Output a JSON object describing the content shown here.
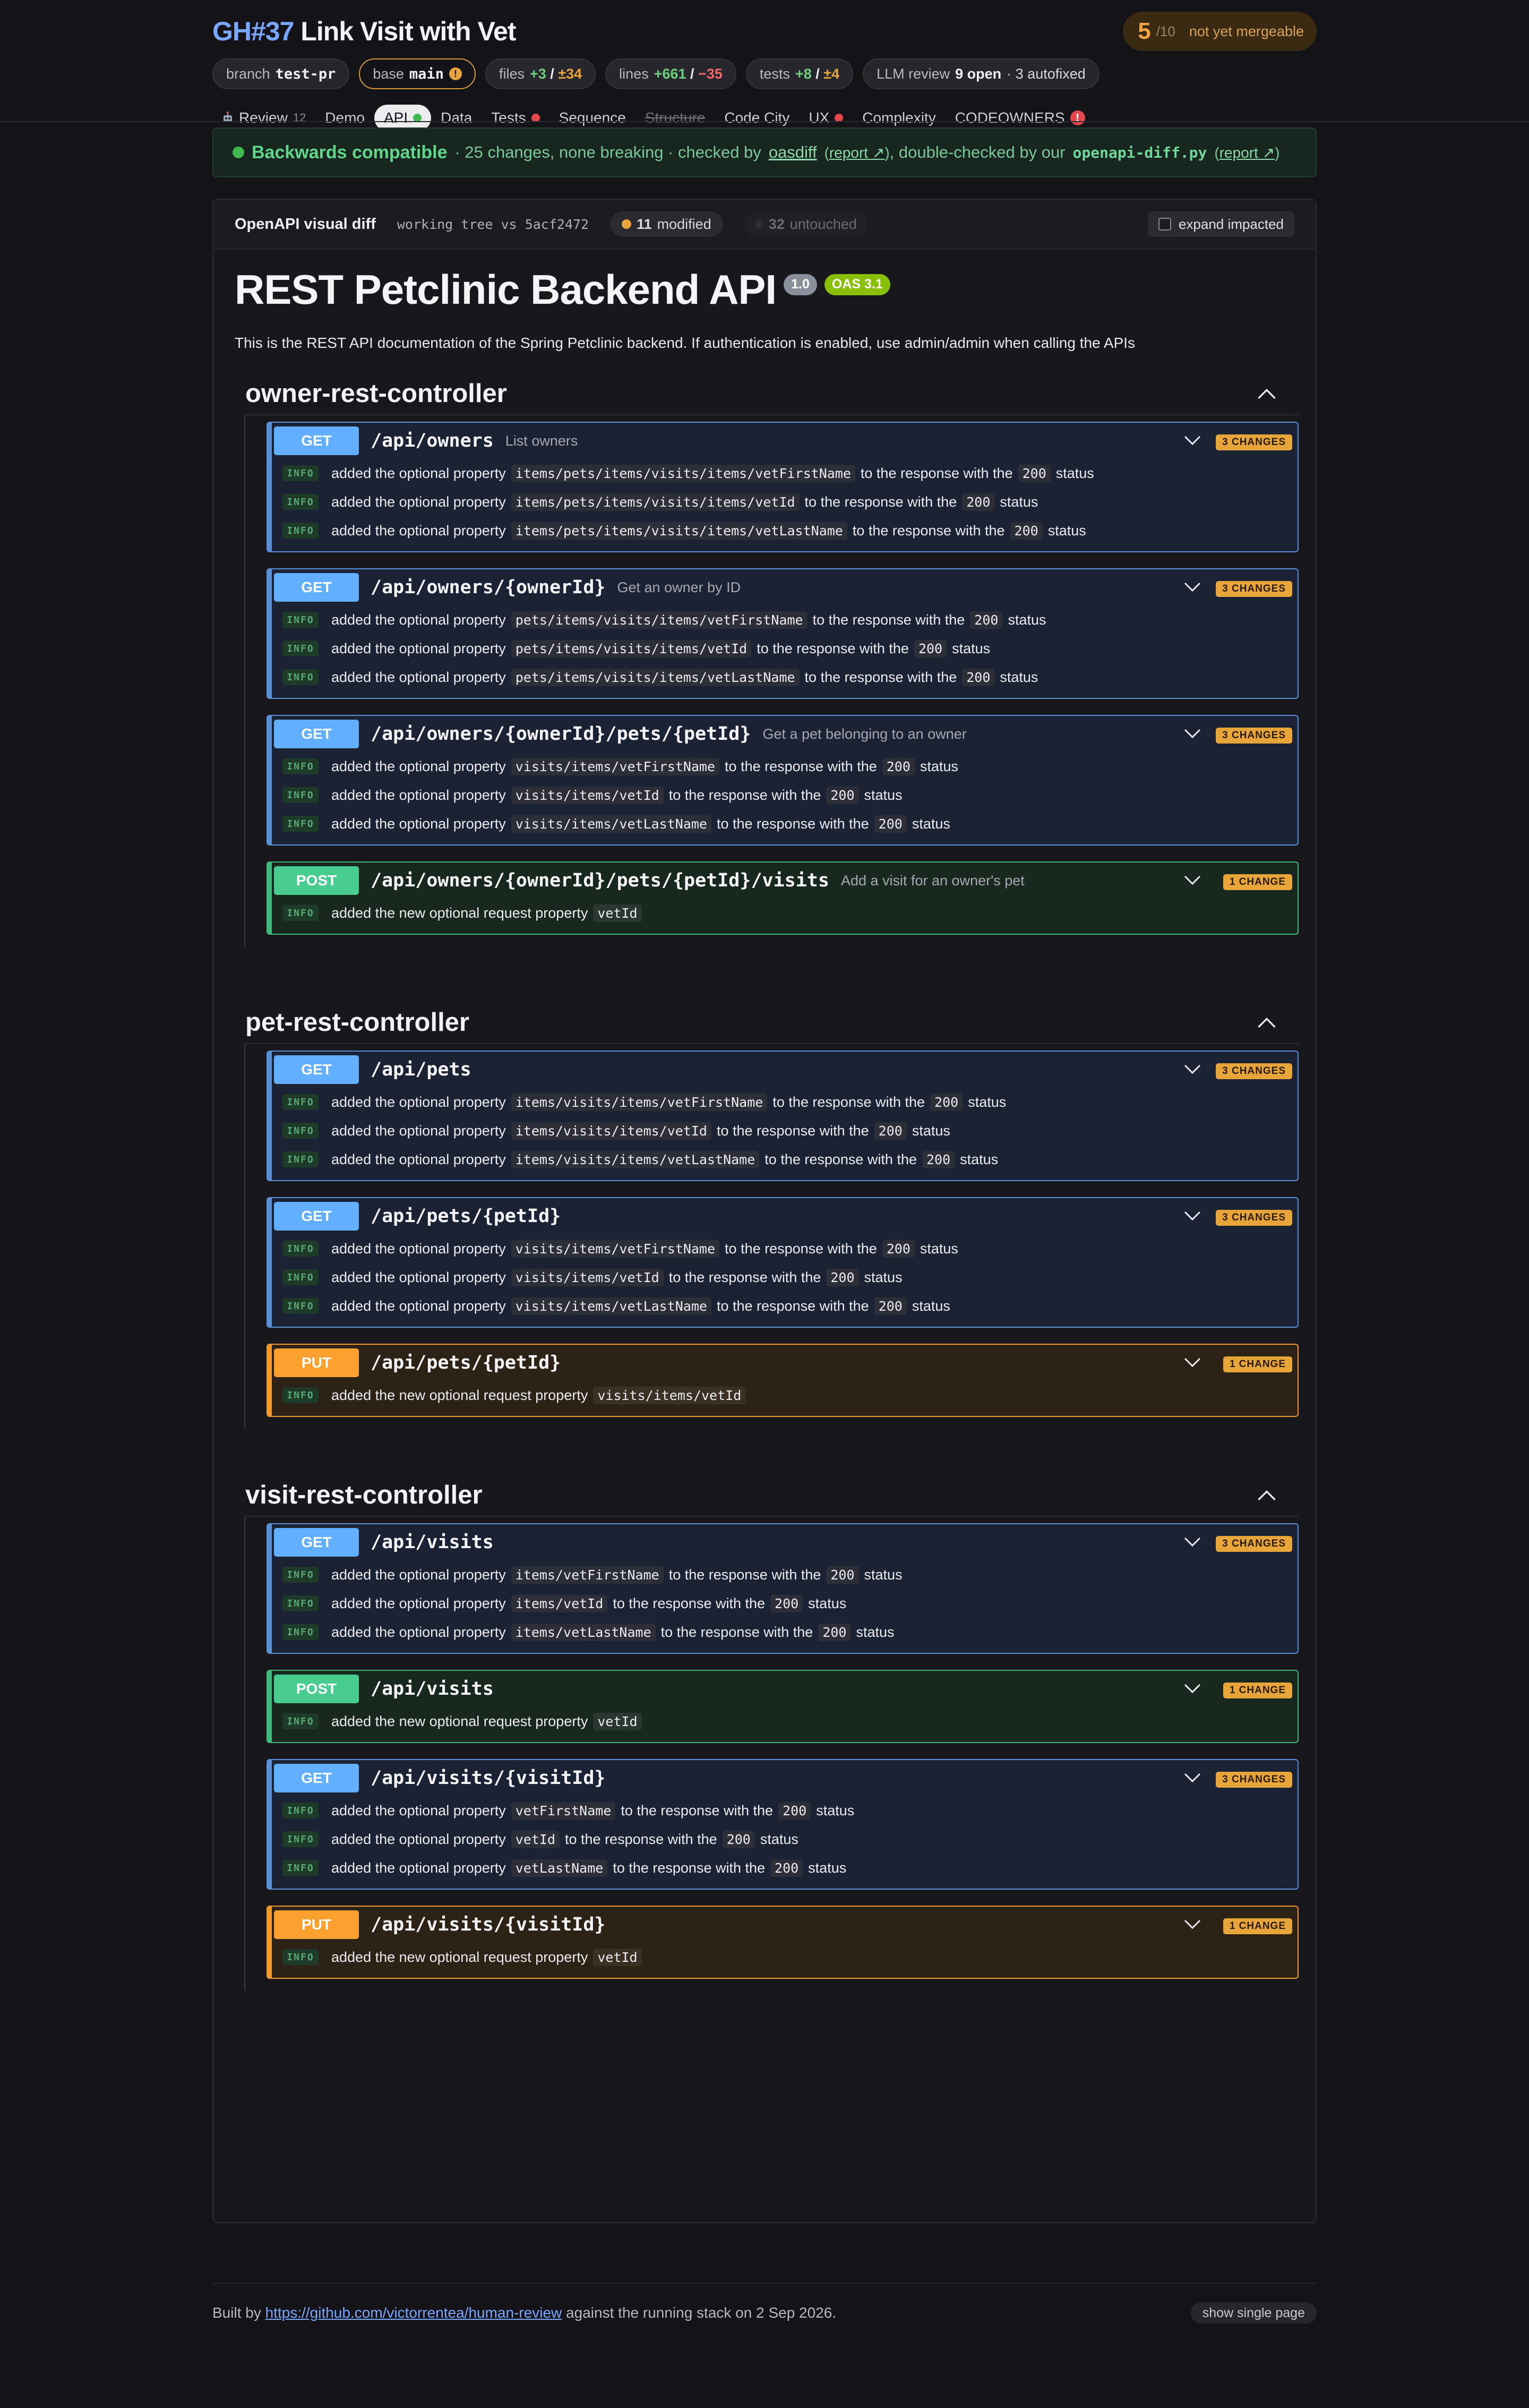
{
  "header": {
    "pr_number": "GH#37",
    "pr_title": "Link Visit with Vet",
    "score": {
      "value": "5",
      "denominator": "/10",
      "status": "not yet mergeable"
    }
  },
  "chips": {
    "branch_label": "branch",
    "branch_value": "test-pr",
    "base_label": "base",
    "base_value": "main",
    "base_warn": "!",
    "files_label": "files",
    "files_added": "+3",
    "files_sep": "/",
    "files_changed": "±34",
    "lines_label": "lines",
    "lines_added": "+661",
    "lines_sep": "/",
    "lines_removed": "−35",
    "tests_label": "tests",
    "tests_added": "+8",
    "tests_sep": "/",
    "tests_changed": "±4",
    "llm_label": "LLM review",
    "llm_open": "9 open",
    "llm_autofixed": "· 3 autofixed"
  },
  "tabs": {
    "review": "Review",
    "review_count": "12",
    "demo": "Demo",
    "api": "API",
    "data": "Data",
    "tests": "Tests",
    "sequence": "Sequence",
    "structure": "Structure",
    "code_city": "Code City",
    "ux": "UX",
    "complexity": "Complexity",
    "codeowners": "CODEOWNERS",
    "codeowners_alert": "!"
  },
  "compat": {
    "title": "Backwards compatible",
    "summary": "· 25 changes, none breaking · checked by",
    "tool1": "oasdiff",
    "report1": "report ↗",
    "middle": ", double-checked by our",
    "tool2": "openapi-diff.py",
    "report2": "report ↗",
    "open_paren": "(",
    "close_paren1": ")",
    "close_paren2": ")"
  },
  "panel": {
    "title": "OpenAPI visual diff",
    "working_tree": "working tree vs 5acf2472",
    "modified_count": "11",
    "modified_label": "modified",
    "untouched_count": "32",
    "untouched_label": "untouched",
    "expand_label": "expand impacted"
  },
  "api": {
    "title": "REST Petclinic Backend API",
    "version": "1.0",
    "oas": "OAS 3.1",
    "description": "This is the REST API documentation of the Spring Petclinic backend. If authentication is enabled, use admin/admin when calling the APIs"
  },
  "controllers": [
    {
      "name": "owner-rest-controller",
      "ops": [
        {
          "method": "GET",
          "path": "/api/owners",
          "summary": "List owners",
          "badge": "3 CHANGES",
          "changes": [
            {
              "level": "INFO",
              "pre": "added the optional property",
              "code": "items/pets/items/visits/items/vetFirstName",
              "mid": "to the response with the",
              "status": "200",
              "post": "status"
            },
            {
              "level": "INFO",
              "pre": "added the optional property",
              "code": "items/pets/items/visits/items/vetId",
              "mid": "to the response with the",
              "status": "200",
              "post": "status"
            },
            {
              "level": "INFO",
              "pre": "added the optional property",
              "code": "items/pets/items/visits/items/vetLastName",
              "mid": "to the response with the",
              "status": "200",
              "post": "status"
            }
          ]
        },
        {
          "method": "GET",
          "path": "/api/owners/{ownerId}",
          "summary": "Get an owner by ID",
          "badge": "3 CHANGES",
          "changes": [
            {
              "level": "INFO",
              "pre": "added the optional property",
              "code": "pets/items/visits/items/vetFirstName",
              "mid": "to the response with the",
              "status": "200",
              "post": "status"
            },
            {
              "level": "INFO",
              "pre": "added the optional property",
              "code": "pets/items/visits/items/vetId",
              "mid": "to the response with the",
              "status": "200",
              "post": "status"
            },
            {
              "level": "INFO",
              "pre": "added the optional property",
              "code": "pets/items/visits/items/vetLastName",
              "mid": "to the response with the",
              "status": "200",
              "post": "status"
            }
          ]
        },
        {
          "method": "GET",
          "path": "/api/owners/{ownerId}/pets/{petId}",
          "summary": "Get a pet belonging to an owner",
          "badge": "3 CHANGES",
          "changes": [
            {
              "level": "INFO",
              "pre": "added the optional property",
              "code": "visits/items/vetFirstName",
              "mid": "to the response with the",
              "status": "200",
              "post": "status"
            },
            {
              "level": "INFO",
              "pre": "added the optional property",
              "code": "visits/items/vetId",
              "mid": "to the response with the",
              "status": "200",
              "post": "status"
            },
            {
              "level": "INFO",
              "pre": "added the optional property",
              "code": "visits/items/vetLastName",
              "mid": "to the response with the",
              "status": "200",
              "post": "status"
            }
          ]
        },
        {
          "method": "POST",
          "path": "/api/owners/{ownerId}/pets/{petId}/visits",
          "summary": "Add a visit for an owner's pet",
          "badge": "1 CHANGE",
          "changes": [
            {
              "level": "INFO",
              "pre": "added the new optional request property",
              "code": "vetId",
              "mid": "",
              "status": "",
              "post": ""
            }
          ]
        }
      ]
    },
    {
      "name": "pet-rest-controller",
      "ops": [
        {
          "method": "GET",
          "path": "/api/pets",
          "summary": "",
          "badge": "3 CHANGES",
          "changes": [
            {
              "level": "INFO",
              "pre": "added the optional property",
              "code": "items/visits/items/vetFirstName",
              "mid": "to the response with the",
              "status": "200",
              "post": "status"
            },
            {
              "level": "INFO",
              "pre": "added the optional property",
              "code": "items/visits/items/vetId",
              "mid": "to the response with the",
              "status": "200",
              "post": "status"
            },
            {
              "level": "INFO",
              "pre": "added the optional property",
              "code": "items/visits/items/vetLastName",
              "mid": "to the response with the",
              "status": "200",
              "post": "status"
            }
          ]
        },
        {
          "method": "GET",
          "path": "/api/pets/{petId}",
          "summary": "",
          "badge": "3 CHANGES",
          "changes": [
            {
              "level": "INFO",
              "pre": "added the optional property",
              "code": "visits/items/vetFirstName",
              "mid": "to the response with the",
              "status": "200",
              "post": "status"
            },
            {
              "level": "INFO",
              "pre": "added the optional property",
              "code": "visits/items/vetId",
              "mid": "to the response with the",
              "status": "200",
              "post": "status"
            },
            {
              "level": "INFO",
              "pre": "added the optional property",
              "code": "visits/items/vetLastName",
              "mid": "to the response with the",
              "status": "200",
              "post": "status"
            }
          ]
        },
        {
          "method": "PUT",
          "path": "/api/pets/{petId}",
          "summary": "",
          "badge": "1 CHANGE",
          "changes": [
            {
              "level": "INFO",
              "pre": "added the new optional request property",
              "code": "visits/items/vetId",
              "mid": "",
              "status": "",
              "post": ""
            }
          ]
        }
      ]
    },
    {
      "name": "visit-rest-controller",
      "ops": [
        {
          "method": "GET",
          "path": "/api/visits",
          "summary": "",
          "badge": "3 CHANGES",
          "changes": [
            {
              "level": "INFO",
              "pre": "added the optional property",
              "code": "items/vetFirstName",
              "mid": "to the response with the",
              "status": "200",
              "post": "status"
            },
            {
              "level": "INFO",
              "pre": "added the optional property",
              "code": "items/vetId",
              "mid": "to the response with the",
              "status": "200",
              "post": "status"
            },
            {
              "level": "INFO",
              "pre": "added the optional property",
              "code": "items/vetLastName",
              "mid": "to the response with the",
              "status": "200",
              "post": "status"
            }
          ]
        },
        {
          "method": "POST",
          "path": "/api/visits",
          "summary": "",
          "badge": "1 CHANGE",
          "changes": [
            {
              "level": "INFO",
              "pre": "added the new optional request property",
              "code": "vetId",
              "mid": "",
              "status": "",
              "post": ""
            }
          ]
        },
        {
          "method": "GET",
          "path": "/api/visits/{visitId}",
          "summary": "",
          "badge": "3 CHANGES",
          "changes": [
            {
              "level": "INFO",
              "pre": "added the optional property",
              "code": "vetFirstName",
              "mid": "to the response with the",
              "status": "200",
              "post": "status"
            },
            {
              "level": "INFO",
              "pre": "added the optional property",
              "code": "vetId",
              "mid": "to the response with the",
              "status": "200",
              "post": "status"
            },
            {
              "level": "INFO",
              "pre": "added the optional property",
              "code": "vetLastName",
              "mid": "to the response with the",
              "status": "200",
              "post": "status"
            }
          ]
        },
        {
          "method": "PUT",
          "path": "/api/visits/{visitId}",
          "summary": "",
          "badge": "1 CHANGE",
          "changes": [
            {
              "level": "INFO",
              "pre": "added the new optional request property",
              "code": "vetId",
              "mid": "",
              "status": "",
              "post": ""
            }
          ]
        }
      ]
    }
  ],
  "footer": {
    "built_by": "Built by",
    "link": "https://github.com/victorrentea/human-review",
    "suffix": "against the running stack on 2 Sep 2026.",
    "single_page": "show single page"
  }
}
